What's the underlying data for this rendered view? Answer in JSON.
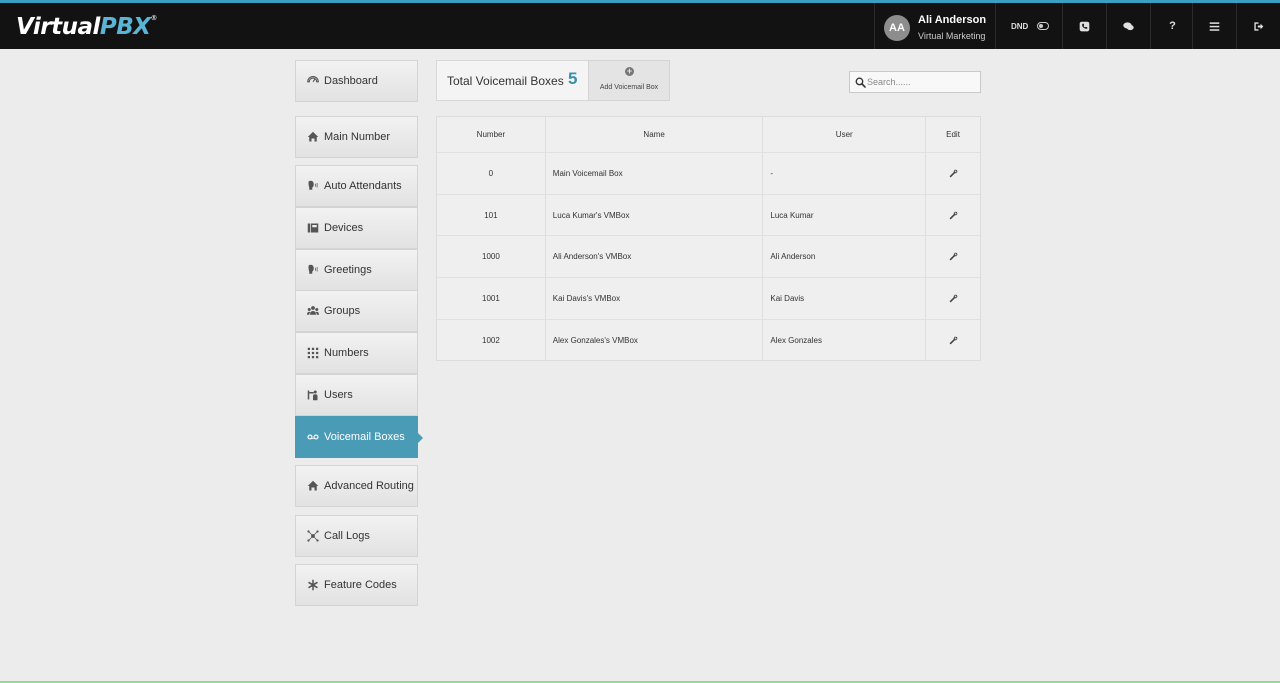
{
  "header": {
    "logo_part1": "Virtual",
    "logo_part2": "PBX",
    "logo_reg": "®",
    "user_initials": "AA",
    "user_name": "Ali Anderson",
    "user_department": "Virtual Marketing",
    "dnd_label": "DND",
    "help_label": "?",
    "icons": [
      "phone-icon",
      "chat-icon",
      "help-icon",
      "menu-icon",
      "logout-icon"
    ]
  },
  "sidebar": {
    "items": [
      {
        "label": "Dashboard",
        "icon": "dashboard-icon"
      },
      {
        "label": "Main Number",
        "icon": "home-icon"
      },
      {
        "label": "Auto Attendants",
        "icon": "speaker-icon"
      },
      {
        "label": "Devices",
        "icon": "devices-icon"
      },
      {
        "label": "Greetings",
        "icon": "speaker-icon"
      },
      {
        "label": "Groups",
        "icon": "groups-icon"
      },
      {
        "label": "Numbers",
        "icon": "keypad-icon"
      },
      {
        "label": "Users",
        "icon": "users-icon"
      },
      {
        "label": "Voicemail Boxes",
        "icon": "voicemail-icon",
        "active": true
      },
      {
        "label": "Advanced Routing",
        "icon": "home-icon"
      },
      {
        "label": "Call Logs",
        "icon": "call-logs-icon"
      },
      {
        "label": "Feature Codes",
        "icon": "asterisk-icon"
      }
    ]
  },
  "main": {
    "total_label": "Total Voicemail Boxes",
    "total_count": "5",
    "add_button_label": "Add Voicemail Box",
    "search_placeholder": "Search......",
    "table": {
      "columns": [
        "Number",
        "Name",
        "User",
        "Edit"
      ],
      "rows": [
        {
          "number": "0",
          "name": "Main Voicemail Box",
          "user": "-"
        },
        {
          "number": "101",
          "name": "Luca Kumar's VMBox",
          "user": "Luca Kumar"
        },
        {
          "number": "1000",
          "name": "Ali Anderson's VMBox",
          "user": "Ali Anderson"
        },
        {
          "number": "1001",
          "name": "Kai Davis's VMBox",
          "user": "Kai Davis"
        },
        {
          "number": "1002",
          "name": "Alex Gonzales's VMBox",
          "user": "Alex Gonzales"
        }
      ]
    }
  },
  "colors": {
    "accent": "#4a9bb5",
    "topbar": "#121212",
    "count": "#3a8fb0"
  }
}
